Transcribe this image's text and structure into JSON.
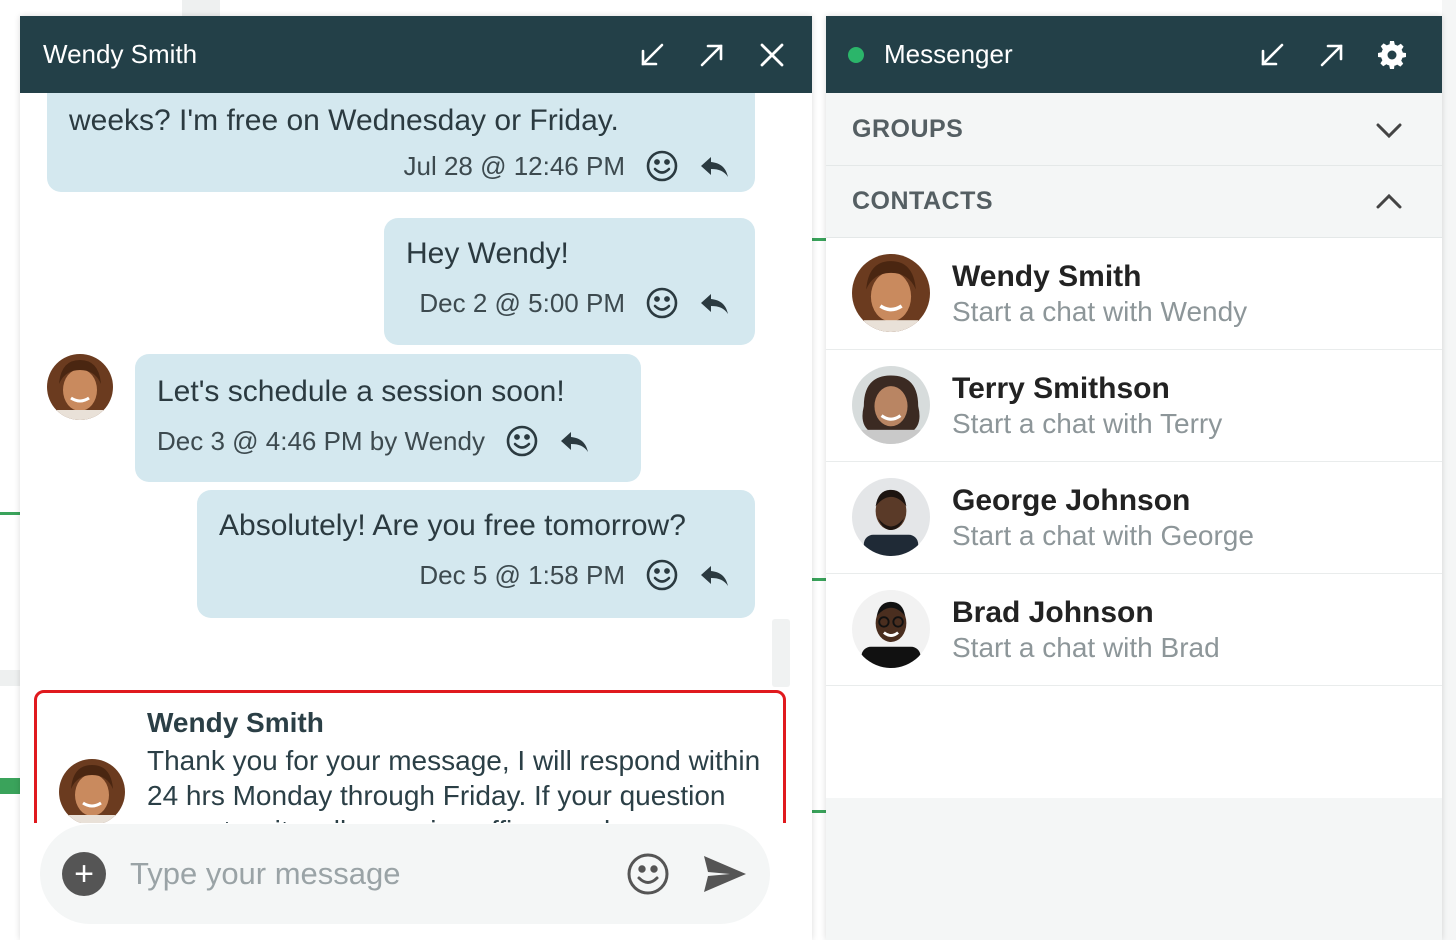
{
  "chat_window": {
    "title": "Wendy Smith",
    "messages": [
      {
        "text": "weeks? I'm free on Wednesday or Friday.",
        "timestamp": "Jul 28 @ 12:46 PM"
      },
      {
        "text": "Hey Wendy!",
        "timestamp": "Dec 2 @ 5:00 PM"
      },
      {
        "text": "Let's schedule a session soon!",
        "timestamp": "Dec 3 @ 4:46 PM by Wendy"
      },
      {
        "text": "Absolutely! Are you free tomorrow?",
        "timestamp": "Dec 5 @ 1:58 PM"
      }
    ],
    "auto_reply": {
      "sender": "Wendy Smith",
      "text": "Thank you for your message, I will respond within 24 hrs Monday through Friday. If your question cannot wait, call me using office number."
    },
    "composer": {
      "placeholder": "Type your message",
      "value": ""
    }
  },
  "messenger": {
    "title": "Messenger",
    "status_color": "#2bb56a",
    "sections": {
      "groups": "GROUPS",
      "contacts": "CONTACTS"
    },
    "contacts": [
      {
        "name": "Wendy Smith",
        "subtitle": "Start a chat with Wendy"
      },
      {
        "name": "Terry Smithson",
        "subtitle": "Start a chat with Terry"
      },
      {
        "name": "George Johnson",
        "subtitle": "Start a chat with George"
      },
      {
        "name": "Brad Johnson",
        "subtitle": "Start a chat with Brad"
      }
    ]
  },
  "colors": {
    "header": "#234048",
    "bubble": "#d4e8ef",
    "highlight_border": "#e0191e"
  },
  "icons": [
    "minimize-icon",
    "expand-icon",
    "close-icon",
    "gear-icon",
    "emoji-icon",
    "reply-icon",
    "plus-icon",
    "send-icon",
    "chevron-down-icon",
    "chevron-up-icon"
  ]
}
